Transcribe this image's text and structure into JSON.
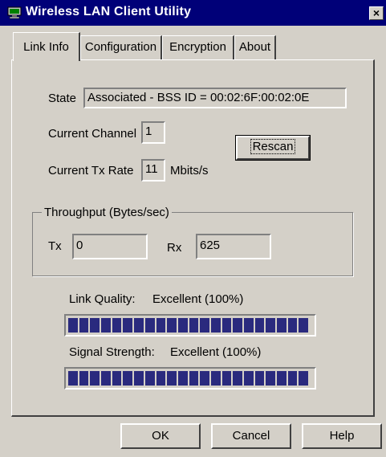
{
  "window": {
    "title": "Wireless LAN Client Utility",
    "close_glyph": "×"
  },
  "tabs": [
    {
      "label": "Link Info",
      "active": true
    },
    {
      "label": "Configuration",
      "active": false
    },
    {
      "label": "Encryption",
      "active": false
    },
    {
      "label": "About",
      "active": false
    }
  ],
  "link_info": {
    "state_label": "State",
    "state_value": "Associated - BSS ID = 00:02:6F:00:02:0E",
    "channel_label": "Current Channel",
    "channel_value": "1",
    "tx_rate_label": "Current Tx Rate",
    "tx_rate_value": "11",
    "tx_rate_unit": "Mbits/s",
    "rescan_label": "Rescan",
    "throughput": {
      "title": "Throughput (Bytes/sec)",
      "tx_label": "Tx",
      "tx_value": "0",
      "rx_label": "Rx",
      "rx_value": "625"
    },
    "link_quality": {
      "label": "Link Quality:",
      "value": "Excellent (100%)",
      "level_percent": 100
    },
    "signal_strength": {
      "label": "Signal Strength:",
      "value": "Excellent (100%)",
      "level_percent": 100
    }
  },
  "buttons": {
    "ok": "OK",
    "cancel": "Cancel",
    "help": "Help"
  },
  "colors": {
    "titlebar": "#000078",
    "bar_fill": "#2a2a7e",
    "face": "#d4d0c8"
  }
}
